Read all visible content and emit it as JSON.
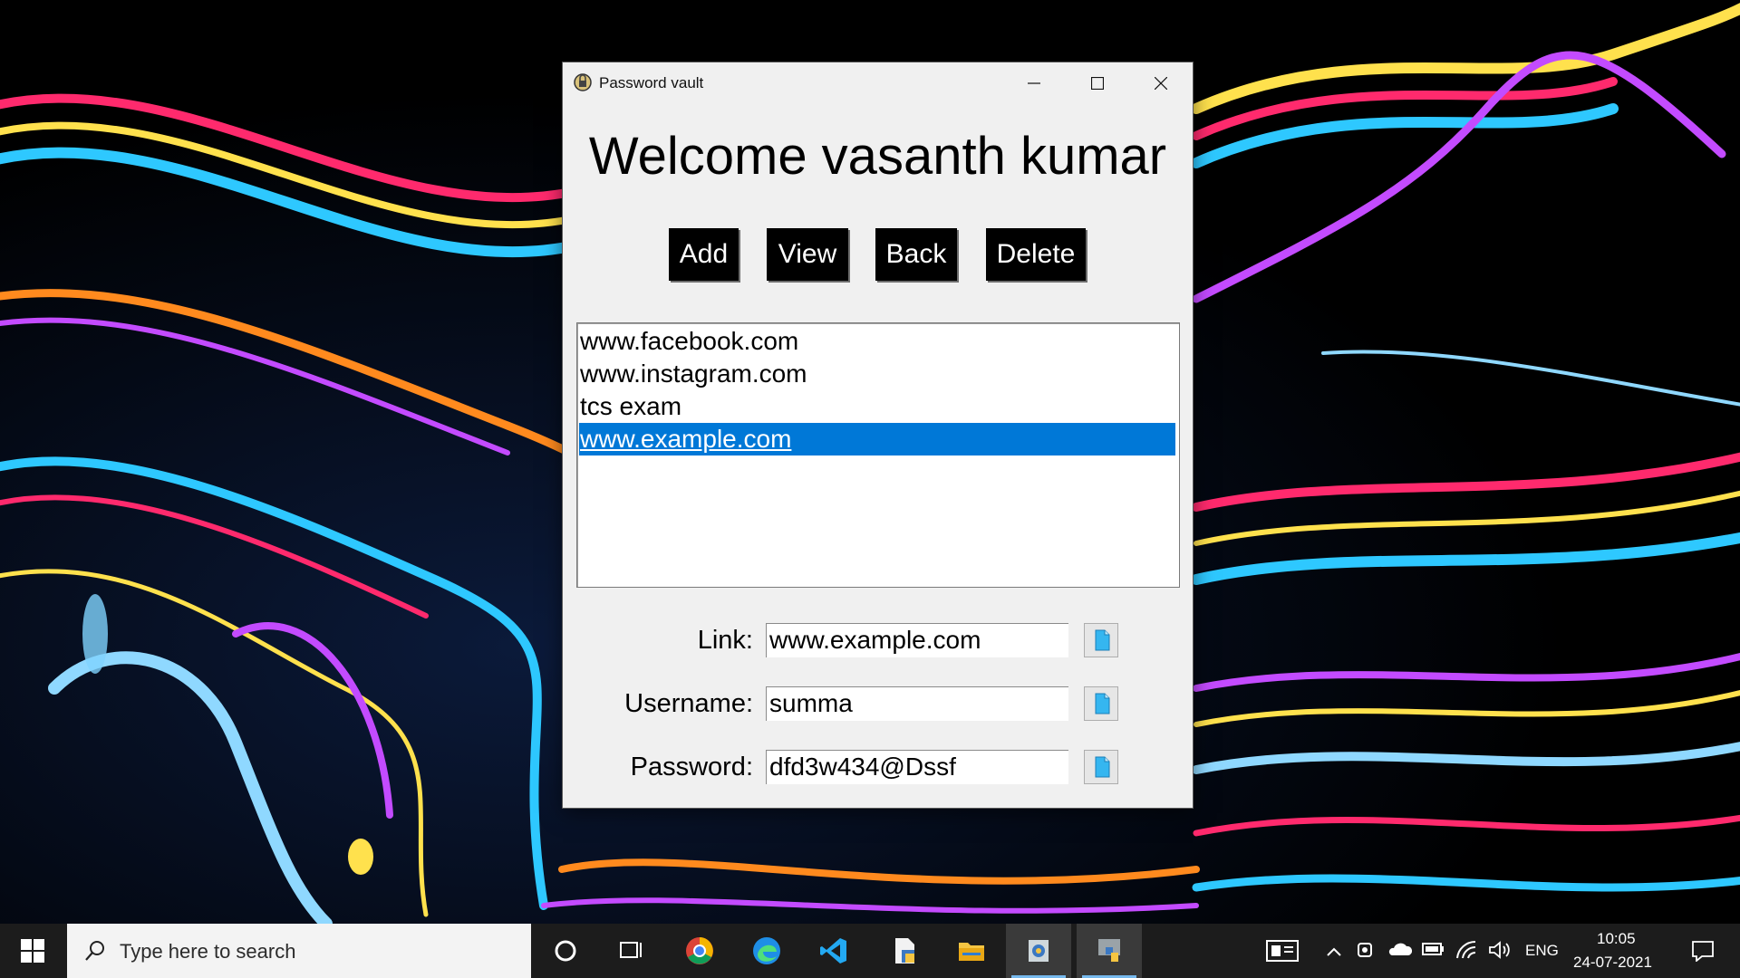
{
  "window": {
    "title": "Password vault",
    "welcome": "Welcome vasanth kumar",
    "buttons": {
      "add": "Add",
      "view": "View",
      "back": "Back",
      "delete": "Delete"
    },
    "list_items": [
      "www.facebook.com",
      "www.instagram.com",
      "tcs exam",
      "www.example.com"
    ],
    "selected_index": 3,
    "fields": {
      "link": {
        "label": "Link:",
        "value": "www.example.com"
      },
      "username": {
        "label": "Username:",
        "value": "summa"
      },
      "password": {
        "label": "Password:",
        "value": "dfd3w434@Dssf"
      }
    }
  },
  "taskbar": {
    "search_placeholder": "Type here to search",
    "apps": [
      "chrome-icon",
      "edge-icon",
      "vscode-icon",
      "document-icon",
      "file-explorer-icon",
      "password-vault-app-icon",
      "python-icon"
    ],
    "tray": {
      "language": "ENG",
      "time": "10:05",
      "date": "24-07-2021"
    }
  },
  "colors": {
    "selection": "#0078d7",
    "button_bg": "#000000",
    "window_bg": "#f0f0f0",
    "taskbar": "#1c1c1c"
  }
}
